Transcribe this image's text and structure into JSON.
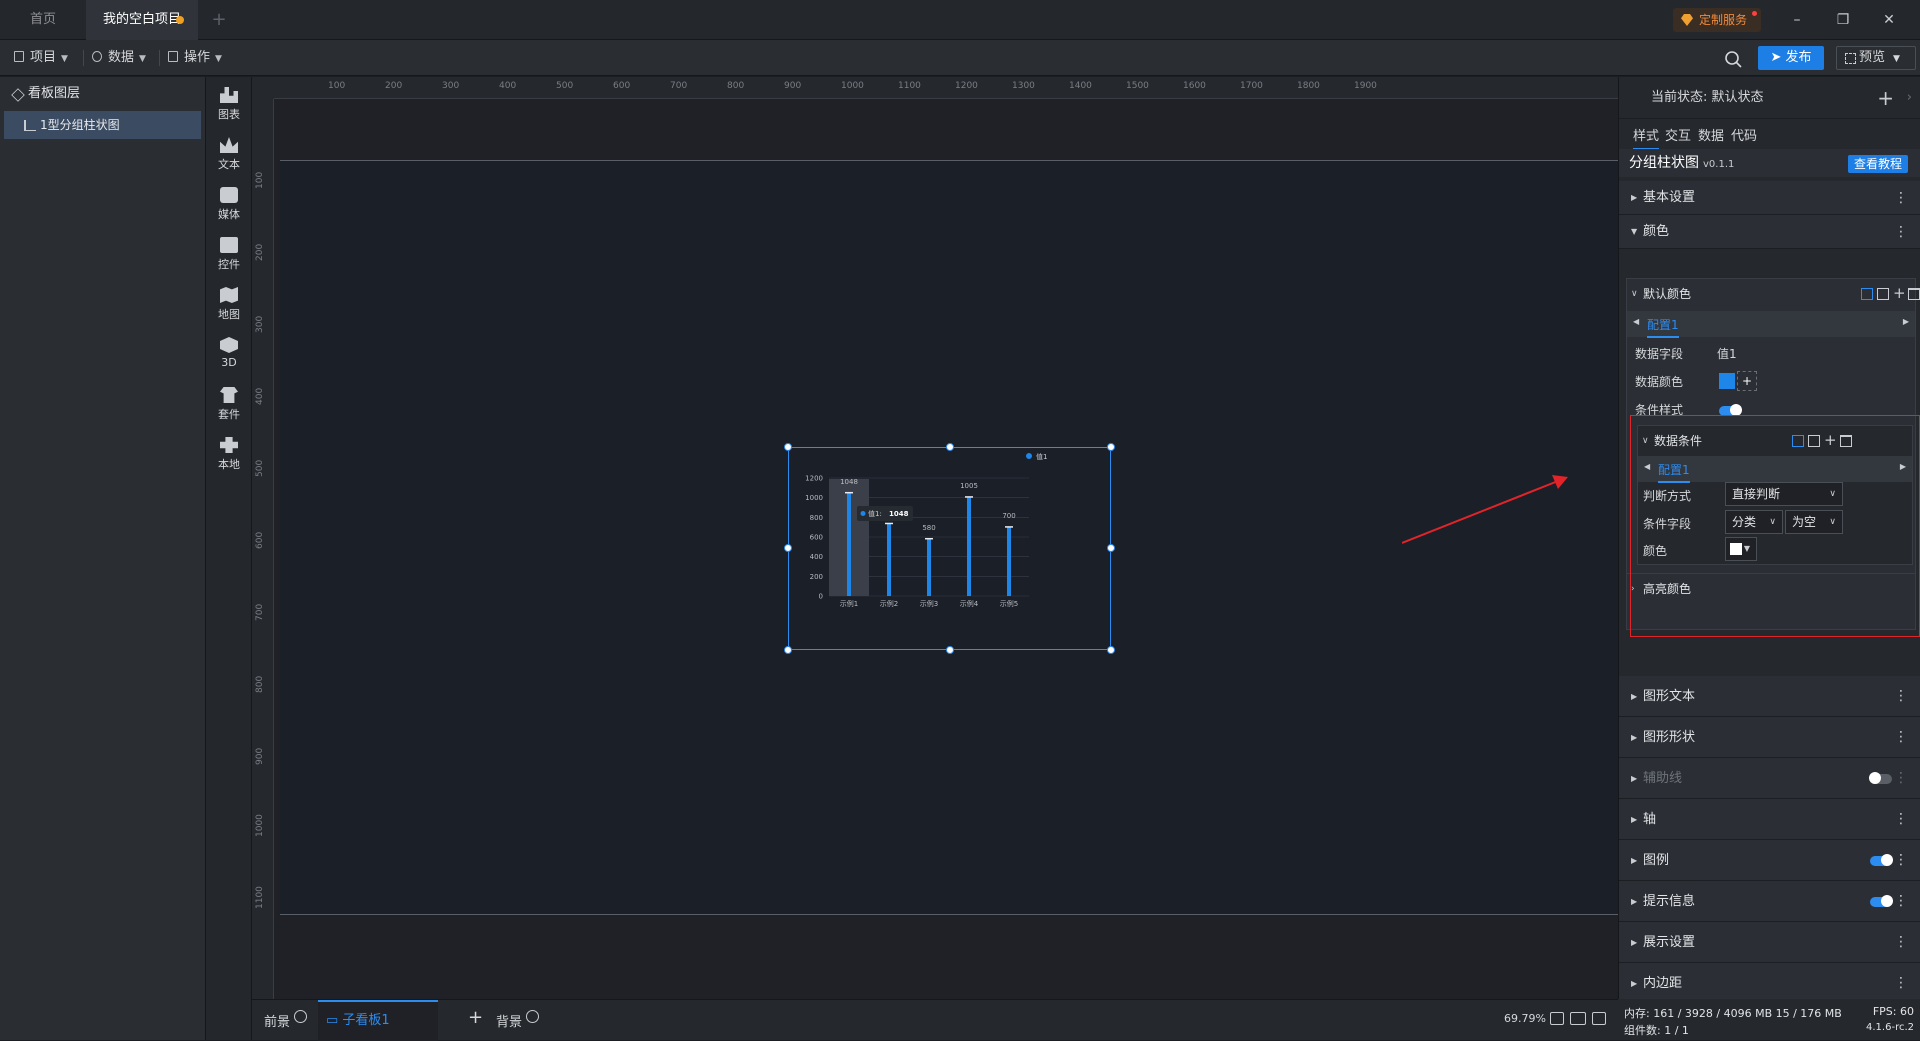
{
  "titlebar": {
    "tabs": [
      "首页",
      "我的空白项目"
    ],
    "custom_service": "定制服务"
  },
  "toolbar": {
    "menus": [
      "项目",
      "数据",
      "操作"
    ],
    "publish": "发布",
    "preview": "预览"
  },
  "layers": {
    "title": "看板图层",
    "item": "1型分组柱状图"
  },
  "components": [
    "图表",
    "文本",
    "媒体",
    "控件",
    "地图",
    "3D",
    "套件",
    "本地"
  ],
  "ruler": {
    "top": [
      "100",
      "200",
      "300",
      "400",
      "500",
      "600",
      "700",
      "800",
      "900",
      "1000",
      "1100",
      "1200",
      "1300",
      "1400",
      "1500",
      "1600",
      "1700",
      "1800",
      "1900"
    ],
    "left": [
      "100",
      "200",
      "300",
      "400",
      "500",
      "600",
      "700",
      "800",
      "900",
      "1000",
      "1100"
    ]
  },
  "chart_data": {
    "type": "bar",
    "categories": [
      "示例1",
      "示例2",
      "示例3",
      "示例4",
      "示例5"
    ],
    "series": [
      {
        "name": "值1",
        "values": [
          1048,
          735,
          580,
          1005,
          700
        ],
        "color": "#1d86e8"
      }
    ],
    "ylim": [
      0,
      1200
    ],
    "yticks": [
      "0",
      "200",
      "400",
      "600",
      "800",
      "1000",
      "1200"
    ],
    "data_labels": [
      "1048",
      "",
      "580",
      "1005",
      "700"
    ],
    "tooltip": {
      "label": "值1:",
      "value": "1048"
    },
    "legend": "top-right"
  },
  "bottombar": {
    "front": "前景",
    "subboard": "子看板1",
    "background": "背景",
    "zoom": "69.79%"
  },
  "panel": {
    "state": "当前状态: 默认状态",
    "tabs": [
      "样式",
      "交互",
      "数据",
      "代码"
    ],
    "component": "分组柱状图",
    "version": "v0.1.1",
    "tutorial": "查看教程",
    "sections_top": [
      "基本设置",
      "颜色"
    ],
    "default_color": "默认颜色",
    "config": "配置1",
    "field_label": "数据字段",
    "field_value": "值1",
    "color_label": "数据颜色",
    "cond_style": "条件样式",
    "data_cond": "数据条件",
    "cond_config": "配置1",
    "judge_label": "判断方式",
    "judge_value": "直接判断",
    "cond_field_label": "条件字段",
    "cond_field_a": "分类",
    "cond_field_b": "为空",
    "cond_color_label": "颜色",
    "highlight": "高亮颜色",
    "sections_bottom": [
      "图形文本",
      "图形形状",
      "辅助线",
      "轴",
      "图例",
      "提示信息",
      "展示设置",
      "内边距"
    ]
  },
  "status": {
    "memory": "内存: 161 / 3928 / 4096 MB 15 / 176 MB",
    "fps": "FPS: 60",
    "count": "组件数: 1 / 1",
    "version": "4.1.6-rc.2"
  }
}
